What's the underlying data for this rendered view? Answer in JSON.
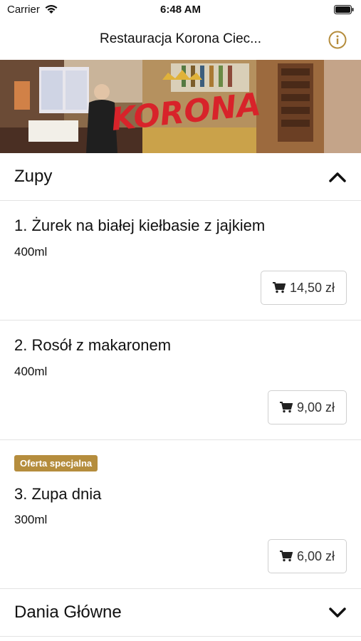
{
  "status_bar": {
    "carrier": "Carrier",
    "time": "6:48 AM"
  },
  "nav": {
    "title": "Restauracja Korona Ciec..."
  },
  "banner": {
    "logo_text": "KORONA"
  },
  "sections": [
    {
      "label": "Zupy",
      "expanded": true,
      "items": [
        {
          "name": "1. Żurek na białej kiełbasie z jajkiem",
          "size": "400ml",
          "price": "14,50 zł"
        },
        {
          "name": "2. Rosół z makaronem",
          "size": "400ml",
          "price": "9,00 zł"
        },
        {
          "badge": "Oferta specjalna",
          "name": "3. Zupa dnia",
          "size": "300ml",
          "price": "6,00 zł"
        }
      ]
    },
    {
      "label": "Dania Główne",
      "expanded": false
    }
  ],
  "colors": {
    "accent": "#b58d3d",
    "divider": "#e3e3e3",
    "logo_red": "#d8232a"
  },
  "icons": [
    "wifi-icon",
    "battery-icon",
    "info-icon",
    "chevron-up-icon",
    "chevron-down-icon",
    "cart-icon"
  ]
}
